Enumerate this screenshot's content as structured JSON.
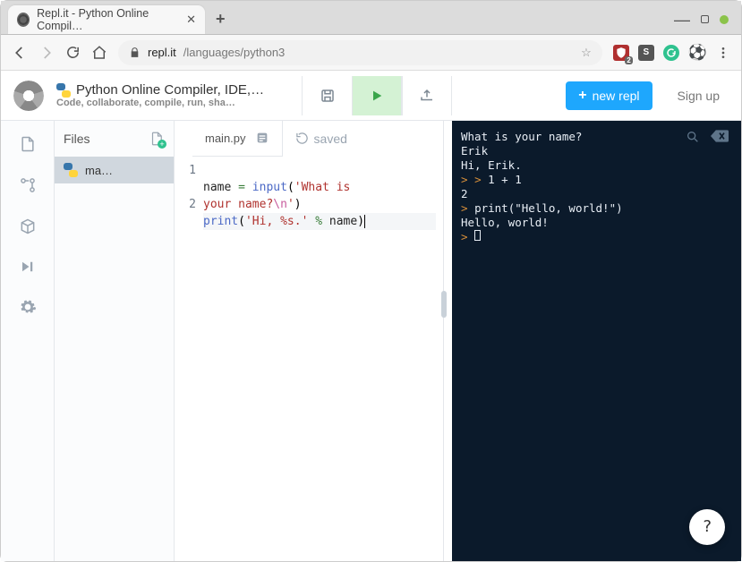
{
  "browser": {
    "tab_title": "Repl.it - Python Online Compil…",
    "url_domain": "repl.it",
    "url_path": "/languages/python3",
    "ext_badge": "2",
    "ext_s": "S"
  },
  "header": {
    "title": "Python Online Compiler, IDE,…",
    "subtitle": "Code, collaborate, compile, run, sha…",
    "new_repl_label": "new repl",
    "signup_label": "Sign up"
  },
  "files": {
    "heading": "Files",
    "items": [
      "ma…"
    ]
  },
  "editor": {
    "tab_label": "main.py",
    "saved_label": "saved",
    "code": {
      "l1_a": "name ",
      "l1_eq": "= ",
      "l1_fn": "input",
      "l1_p1": "(",
      "l1_str1": "'What is ",
      "l1_str2": "your name?",
      "l1_esc": "\\n",
      "l1_str3": "'",
      "l1_p2": ")",
      "l2_fn": "print",
      "l2_p1": "(",
      "l2_str": "'Hi, %s.'",
      "l2_op": " % ",
      "l2_id": "name",
      "l2_p2": ")"
    },
    "lineno1": "1",
    "lineno2": "2"
  },
  "terminal": {
    "lines": {
      "q": "What is your name?",
      "a": "Erik",
      "greet": "Hi, Erik.",
      "expr": "1 + 1",
      "res1": "2",
      "stmt": "print(\"Hello, world!\")",
      "res2": "Hello, world!"
    }
  },
  "help_label": "?"
}
